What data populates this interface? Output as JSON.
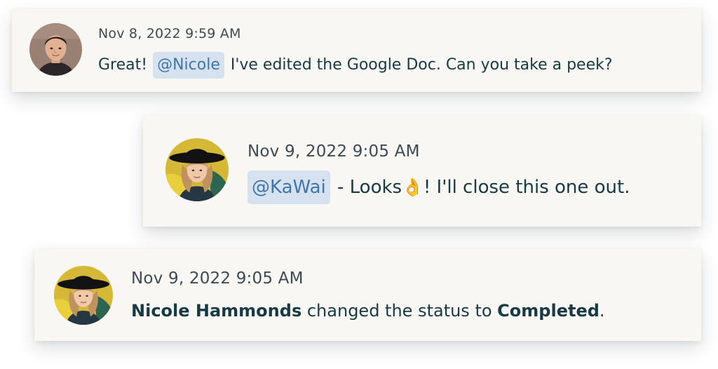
{
  "comments": [
    {
      "timestamp": "Nov 8, 2022 9:59 AM",
      "text_before": "Great! ",
      "mention": "@Nicole",
      "text_after": " I've edited the Google Doc. Can you take a peek?"
    },
    {
      "timestamp": "Nov 9, 2022 9:05 AM",
      "mention": "@KaWai",
      "text_after_1": " - Looks",
      "emoji": "👌",
      "text_after_2": "! I'll close this one out."
    }
  ],
  "status_event": {
    "timestamp": "Nov 9, 2022 9:05 AM",
    "actor": "Nicole Hammonds",
    "text_middle": " changed the status to ",
    "status": "Completed",
    "text_end": "."
  },
  "colors": {
    "card_background": "#f8f7f4",
    "mention_background": "#d6e2ef",
    "mention_text": "#3f76ac",
    "body_text": "#173a45"
  }
}
